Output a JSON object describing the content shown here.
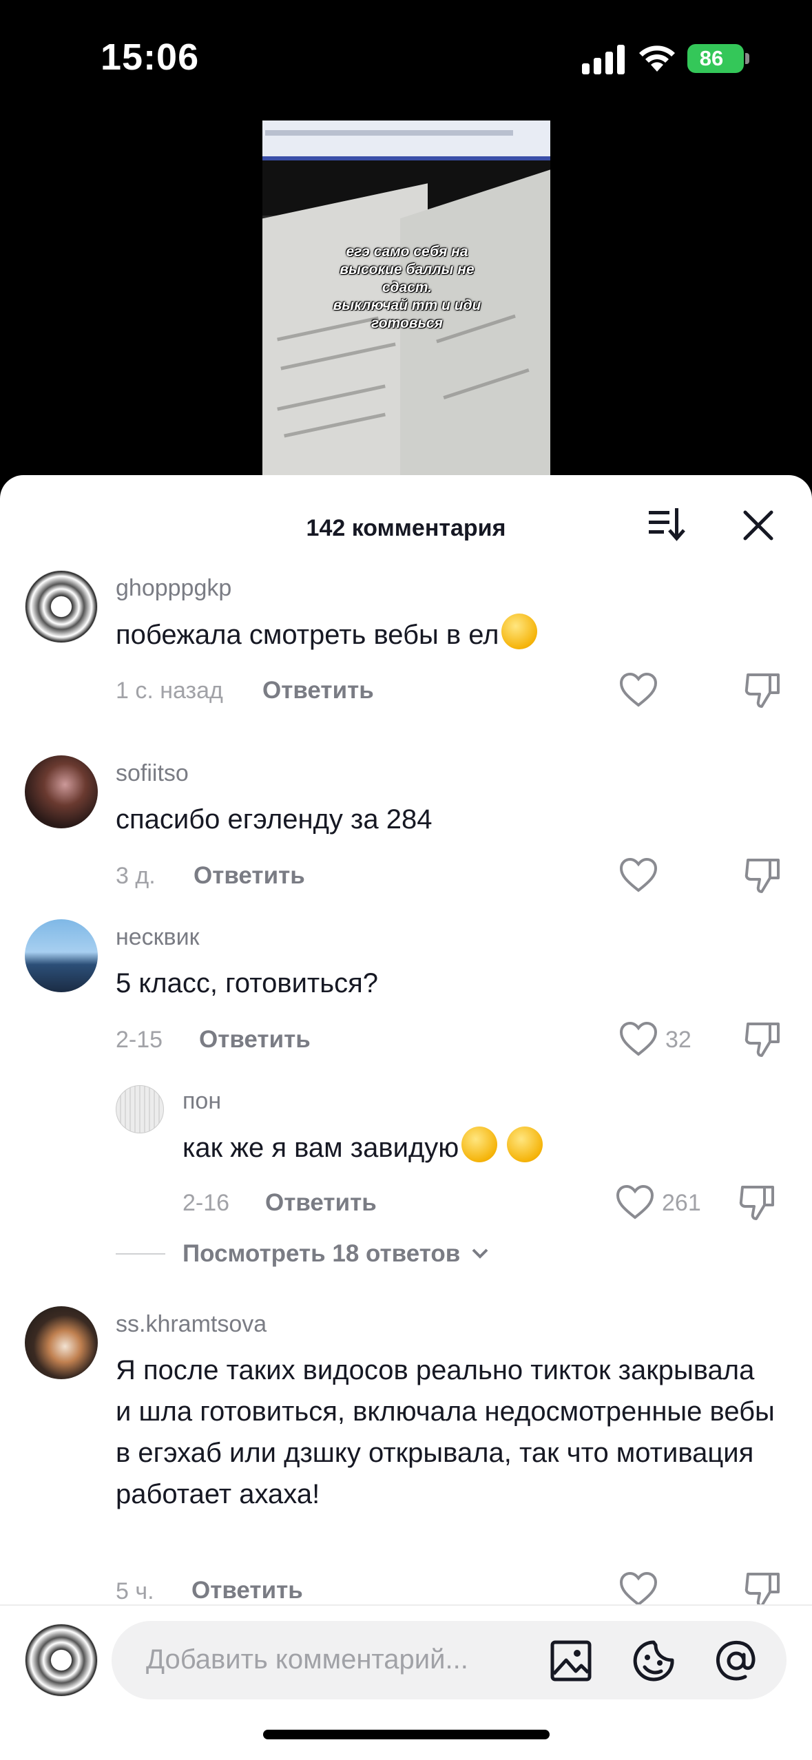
{
  "status_bar": {
    "time": "15:06",
    "battery": "86"
  },
  "video": {
    "caption": "егэ само себя на\nвысокие баллы не\nсдаст.\nвыключай тт и иди\nготовься"
  },
  "comments_sheet": {
    "title": "142 комментария",
    "reply_label": "Ответить",
    "comments": [
      {
        "username": "ghopppgkp",
        "text": "побежала смотреть вебы в ел",
        "emoji": "smiling-face-with-hearts",
        "time": "1 с. назад",
        "likes": ""
      },
      {
        "username": "sofiitso",
        "text": "спасибо егэленду за 284",
        "time": "3 д.",
        "likes": ""
      },
      {
        "username": "несквик",
        "text": "5 класс, готовиться?",
        "time": "2-15",
        "likes": "32"
      },
      {
        "username": "пон",
        "text": "как же я вам завидую",
        "emoji": "loudly-crying-face",
        "time": "2-16",
        "likes": "261"
      },
      {
        "username": "ss.khramtsova",
        "text": "Я после таких видосов реально тикток закрывала и шла готовиться, включала недосмотренные вебы в егэхаб или дзшку открывала, так что мотивация работает ахаха!",
        "time": "5 ч.",
        "likes": ""
      }
    ],
    "view_replies": "Посмотреть 18 ответов"
  },
  "input": {
    "placeholder": "Добавить комментарий..."
  },
  "icons": [
    "signal-icon",
    "wifi-icon",
    "battery-icon",
    "sort-icon",
    "close-icon",
    "like-icon",
    "dislike-icon",
    "image-icon",
    "sticker-icon",
    "mention-icon",
    "chevron-down-icon"
  ]
}
